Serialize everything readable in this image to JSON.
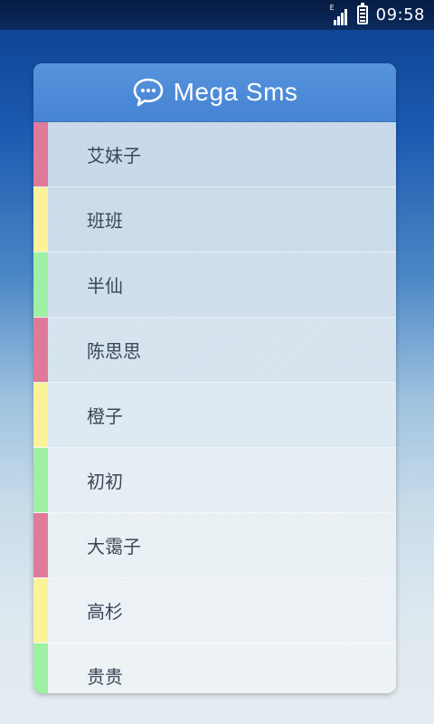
{
  "status_bar": {
    "time": "09:58",
    "network_label": "E",
    "signal_icon": "signal-icon",
    "battery_icon": "battery-icon"
  },
  "app": {
    "title": "Mega Sms",
    "icon": "chat-bubble-icon",
    "header_color": "#4a88d7"
  },
  "contacts": [
    {
      "name": "艾妹子",
      "stripe_color": "#e07a9b",
      "row_color": "#c7d8e8"
    },
    {
      "name": "班班",
      "stripe_color": "#fbf29a",
      "row_color": "#cbdbea"
    },
    {
      "name": "半仙",
      "stripe_color": "#9ef0a4",
      "row_color": "#cfdeeb"
    },
    {
      "name": "陈思思",
      "stripe_color": "#e07a9b",
      "row_color": "#d5e3ee"
    },
    {
      "name": "橙子",
      "stripe_color": "#fbf29a",
      "row_color": "#dde9f1"
    },
    {
      "name": "初初",
      "stripe_color": "#9ef0a4",
      "row_color": "#e6eef3"
    },
    {
      "name": "大霭子",
      "stripe_color": "#e07a9b",
      "row_color": "#e9f0f4"
    },
    {
      "name": "高杉",
      "stripe_color": "#fbf29a",
      "row_color": "#ebf1f5"
    },
    {
      "name": "贵贵",
      "stripe_color": "#9ef0a4",
      "row_color": "#edf2f5"
    }
  ]
}
